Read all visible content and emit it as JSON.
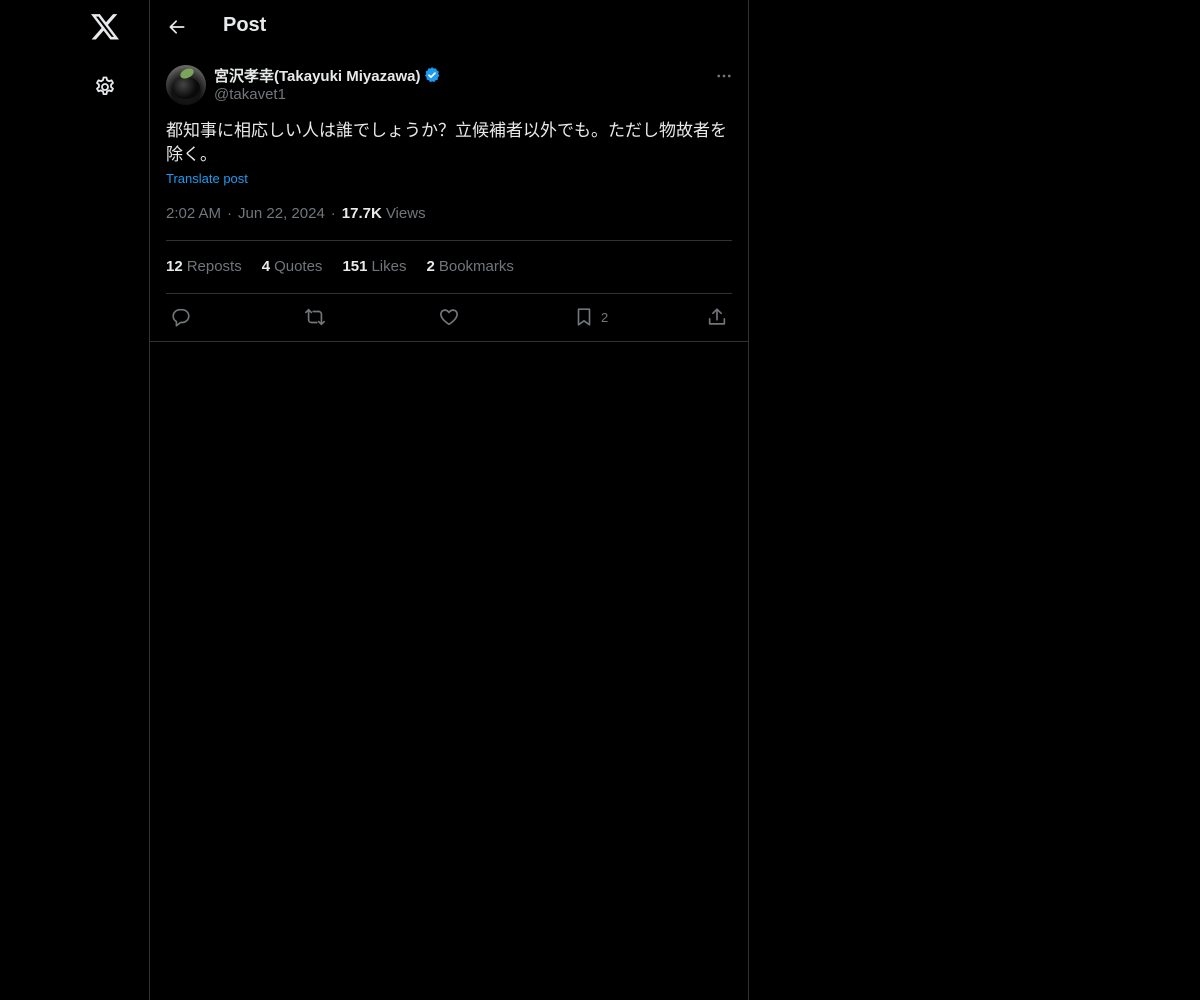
{
  "header": {
    "title": "Post"
  },
  "nav": {
    "items": [
      {
        "icon": "x-logo-icon",
        "label": "X"
      },
      {
        "icon": "gear-icon",
        "label": "Settings"
      }
    ]
  },
  "post": {
    "author": {
      "display_name": "宮沢孝幸(Takayuki Miyazawa)",
      "handle": "@takavet1",
      "verified": true
    },
    "text": "都知事に相応しい人は誰でしょうか？立候補者以外でも。ただし物故者を除く。",
    "translate_label": "Translate post",
    "time": "2:02 AM",
    "date": "Jun 22, 2024",
    "views_count": "17.7K",
    "views_label": "Views",
    "separator": "·",
    "stats": {
      "reposts": {
        "count": "12",
        "label": "Reposts"
      },
      "quotes": {
        "count": "4",
        "label": "Quotes"
      },
      "likes": {
        "count": "151",
        "label": "Likes"
      },
      "bookmarks": {
        "count": "2",
        "label": "Bookmarks"
      }
    },
    "actions": {
      "bookmark_count": "2"
    }
  },
  "colors": {
    "background": "#000000",
    "text_primary": "#e7e9ea",
    "text_secondary": "#71767b",
    "accent": "#1d9bf0",
    "border": "#2f3336"
  }
}
